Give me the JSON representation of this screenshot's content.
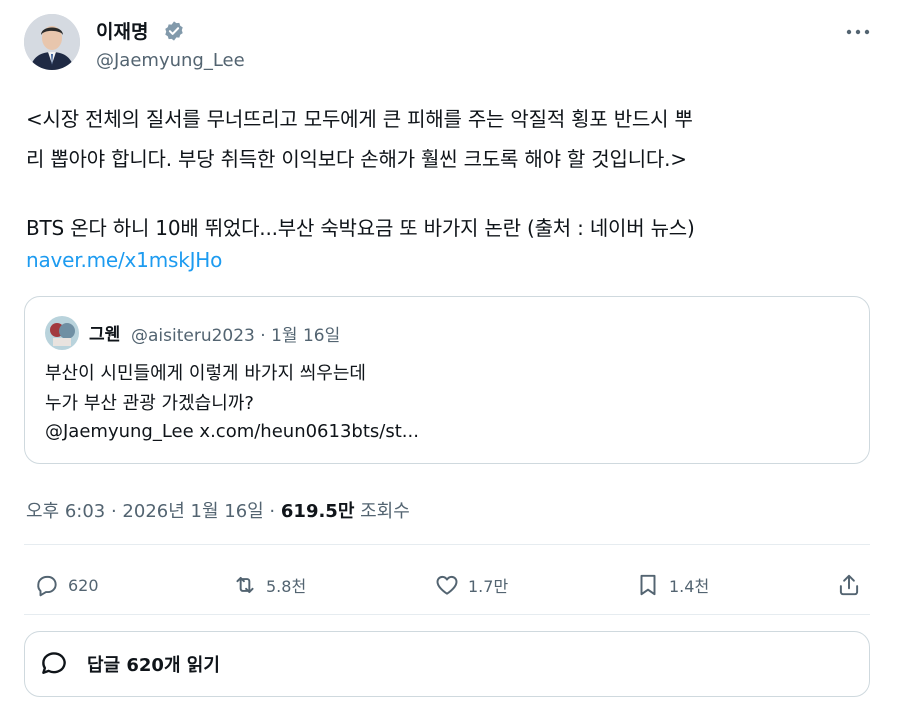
{
  "author": {
    "name": "이재명",
    "handle": "@Jaemyung_Lee"
  },
  "tweet": {
    "lines": [
      "<시장 전체의 질서를 무너뜨리고 모두에게 큰 피해를 주는 악질적 횡포 반드시 뿌",
      "리 뽑아야 합니다. 부당 취득한 이익보다 손해가 훨씬 크도록 해야 할 것입니다.>",
      "BTS 온다 하니 10배 뛰었다...부산 숙박요금 또 바가지 논란 (출처 : 네이버 뉴스)"
    ],
    "link": "naver.me/x1mskJHo"
  },
  "quote": {
    "name": "그웬",
    "meta": "@aisiteru2023 · 1월 16일",
    "lines": [
      "부산이 시민들에게 이렇게 바가지 씌우는데",
      "누가 부산 관광 가겠습니까?",
      "@Jaemyung_Lee x.com/heun0613bts/st..."
    ]
  },
  "meta": {
    "time": "오후 6:03 · 2026년 1월 16일 · ",
    "views": "619.5만",
    "views_label": " 조회수"
  },
  "actions": {
    "replies": "620",
    "retweets": "5.8천",
    "likes": "1.7만",
    "bookmarks": "1.4천"
  },
  "reply_button": "답글 620개 읽기",
  "colors": {
    "link": "#1d9bf0",
    "secondary_text": "#536471",
    "border": "#cfd9de"
  },
  "icons": [
    "verified-badge-icon",
    "more-icon",
    "reply-icon",
    "retweet-icon",
    "like-icon",
    "bookmark-icon",
    "share-icon",
    "speech-bubble-icon"
  ]
}
